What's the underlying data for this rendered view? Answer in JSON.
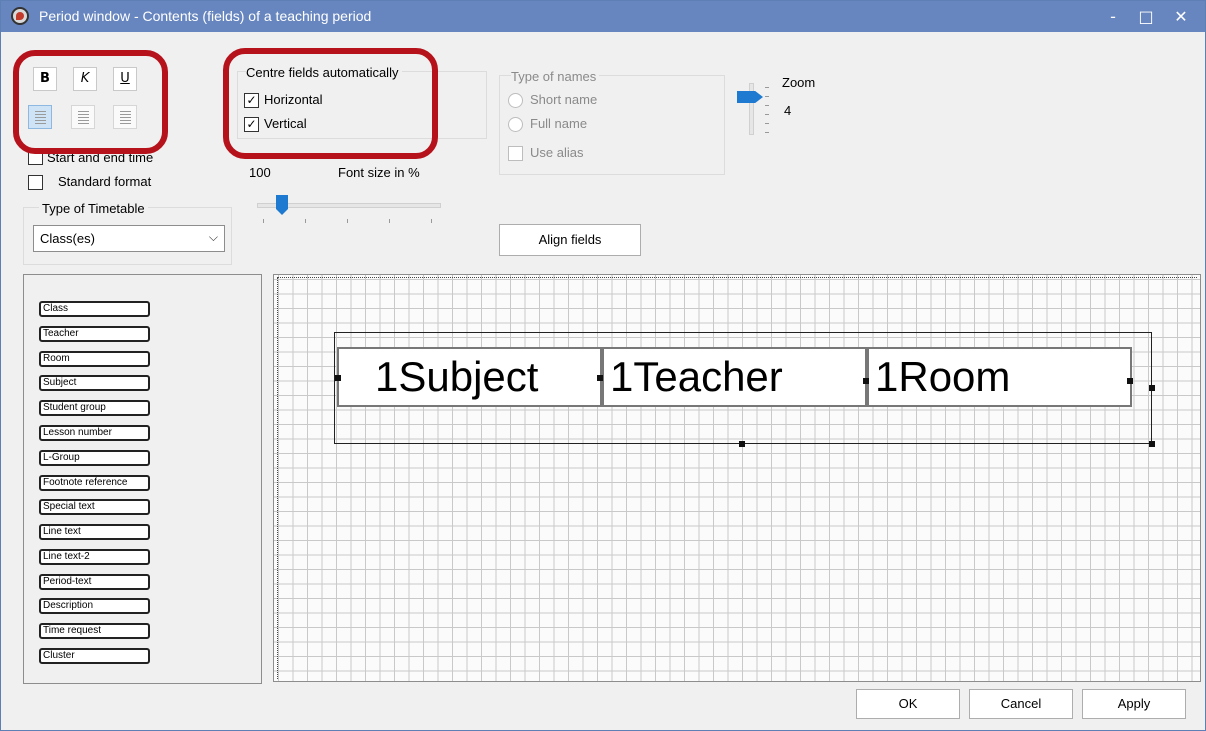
{
  "window": {
    "title": "Period window - Contents (fields) of a teaching period",
    "controls": {
      "minimize": "-",
      "maximize": "□",
      "close": "✕"
    }
  },
  "format": {
    "bold": "B",
    "italic": "K",
    "underline": "U",
    "align_left_icon": "align-left-icon",
    "align_center_icon": "align-center-icon",
    "align_right_icon": "align-right-icon"
  },
  "centre_fields": {
    "label": "Centre fields automatically",
    "horizontal": {
      "label": "Horizontal",
      "checked": true
    },
    "vertical": {
      "label": "Vertical",
      "checked": true
    }
  },
  "options": {
    "start_end_time": {
      "label": "Start and end time",
      "checked": false
    },
    "standard_format": {
      "label": "Standard format",
      "checked": false
    }
  },
  "font_size": {
    "value": "100",
    "label": "Font size in %"
  },
  "type_of_names": {
    "label": "Type of names",
    "short_name": "Short name",
    "full_name": "Full name",
    "use_alias": "Use alias"
  },
  "zoom": {
    "label": "Zoom",
    "value": "4"
  },
  "timetable": {
    "label": "Type of Timetable",
    "selected": "Class(es)"
  },
  "align_fields": "Align fields",
  "field_list": [
    "Class",
    "Teacher",
    "Room",
    "Subject",
    "Student group",
    "Lesson number",
    "L-Group",
    "Footnote reference",
    "Special text",
    "Line text",
    "Line text-2",
    "Period-text",
    "Description",
    "Time request",
    "Cluster"
  ],
  "lesson_fields": [
    "1Subject",
    "1Teacher",
    "1Room"
  ],
  "buttons": {
    "ok": "OK",
    "cancel": "Cancel",
    "apply": "Apply"
  },
  "colors": {
    "titlebar": "#6786bf",
    "highlight": "#b5121b",
    "accent": "#1e7ad0"
  }
}
